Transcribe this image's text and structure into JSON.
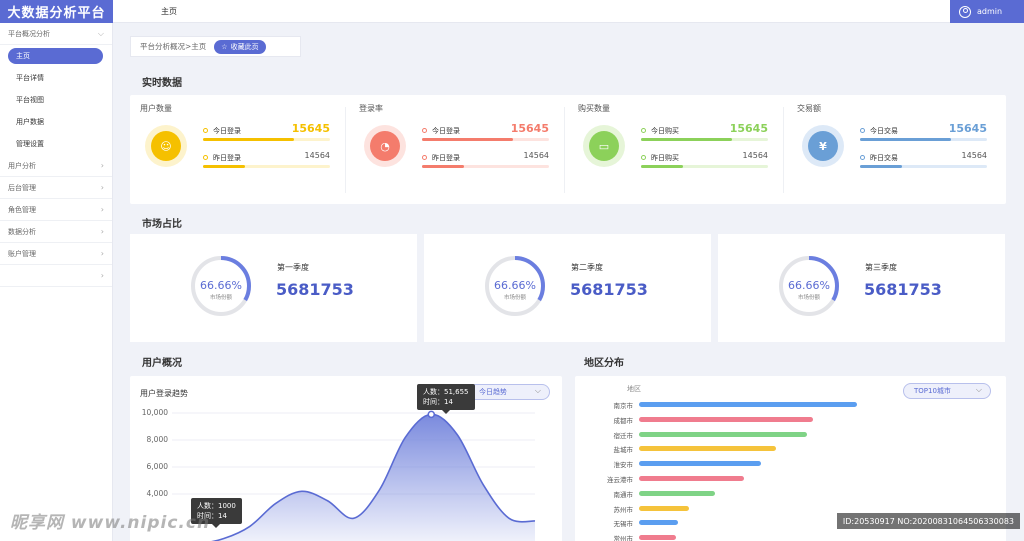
{
  "app": {
    "title": "大数据分析平台"
  },
  "topbar": {
    "home": "主页",
    "user": "admin"
  },
  "sidebar": {
    "groups": [
      {
        "label": "平台概况分析",
        "items": [
          "主页",
          "平台详情",
          "平台视图",
          "用户数据",
          "管理设置"
        ],
        "active": 0
      },
      {
        "label": "用户分析"
      },
      {
        "label": "后台管理"
      },
      {
        "label": "角色管理"
      },
      {
        "label": "数据分析"
      },
      {
        "label": "账户管理"
      },
      {
        "label": ""
      }
    ]
  },
  "breadcrumb": {
    "path": "平台分析概况>主页",
    "fav_label": "收藏此页"
  },
  "realtime": {
    "title": "实时数据",
    "cards": [
      {
        "label": "用户数量",
        "icon": "user-icon",
        "color": "#f5c000",
        "bg": "#fdf3cc",
        "row1_label": "今日登录",
        "row1_value": "15645",
        "row1_frac": 0.72,
        "row2_label": "昨日登录",
        "row2_value": "14564",
        "row2_frac": 0.33
      },
      {
        "label": "登录率",
        "icon": "pie-icon",
        "color": "#f47c6c",
        "bg": "#fde3df",
        "row1_label": "今日登录",
        "row1_value": "15645",
        "row1_frac": 0.72,
        "row2_label": "昨日登录",
        "row2_value": "14564",
        "row2_frac": 0.33
      },
      {
        "label": "购买数量",
        "icon": "cart-icon",
        "color": "#8cd15a",
        "bg": "#e6f5d8",
        "row1_label": "今日购买",
        "row1_value": "15645",
        "row1_frac": 0.72,
        "row2_label": "昨日购买",
        "row2_value": "14564",
        "row2_frac": 0.33
      },
      {
        "label": "交易额",
        "icon": "yen-icon",
        "color": "#6a9fd6",
        "bg": "#dde9f7",
        "row1_label": "今日交易",
        "row1_value": "15645",
        "row1_frac": 0.72,
        "row2_label": "昨日交易",
        "row2_value": "14564",
        "row2_frac": 0.33
      }
    ]
  },
  "market": {
    "title": "市场占比",
    "cards": [
      {
        "quarter": "第一季度",
        "value": "5681753",
        "pct": "66.66%",
        "pct_label": "市场份额",
        "frac": 0.3333
      },
      {
        "quarter": "第二季度",
        "value": "5681753",
        "pct": "66.66%",
        "pct_label": "市场份额",
        "frac": 0.3333
      },
      {
        "quarter": "第三季度",
        "value": "5681753",
        "pct": "66.66%",
        "pct_label": "市场份额",
        "frac": 0.3333
      }
    ]
  },
  "user_overview": {
    "title": "用户概况",
    "chart_title": "用户登录趋势",
    "dropdown": "今日趋势",
    "tooltip_peak": {
      "line1": "人数：51,655",
      "line2": "时间：14"
    },
    "tooltip_low": {
      "line1": "人数：1000",
      "line2": "时间：14"
    }
  },
  "region": {
    "title": "地区分布",
    "header": "地区",
    "dropdown": "TOP10城市"
  },
  "chart_data": [
    {
      "type": "area",
      "title": "用户登录趋势",
      "yticks": [
        "10,000",
        "8,000",
        "6,000",
        "4,000"
      ],
      "ylim": [
        0,
        10000
      ],
      "x": [
        0,
        1,
        2,
        3,
        4,
        5,
        6,
        7,
        8,
        9,
        10,
        11,
        12,
        13,
        14
      ],
      "values": [
        200,
        300,
        700,
        1600,
        3300,
        4200,
        3500,
        2200,
        4300,
        8200,
        9900,
        8400,
        4700,
        2200,
        2000
      ],
      "grid": true,
      "color": "#7384dc"
    },
    {
      "type": "bar",
      "orientation": "horizontal",
      "categories": [
        "南京市",
        "成都市",
        "宿迁市",
        "盐城市",
        "淮安市",
        "连云港市",
        "南通市",
        "苏州市",
        "无锡市",
        "常州市"
      ],
      "values": [
        100,
        80,
        77,
        63,
        56,
        48,
        35,
        23,
        18,
        17
      ],
      "colors": [
        "#5b9ef0",
        "#f07c8e",
        "#7fd386",
        "#f5c33b",
        "#5b9ef0",
        "#f07c8e",
        "#7fd386",
        "#f5c33b",
        "#5b9ef0",
        "#f07c8e"
      ]
    }
  ],
  "watermark": {
    "text": "ID:20530917 NO:20200831064506330083",
    "logo": "昵享网 www.nipic.cn"
  }
}
